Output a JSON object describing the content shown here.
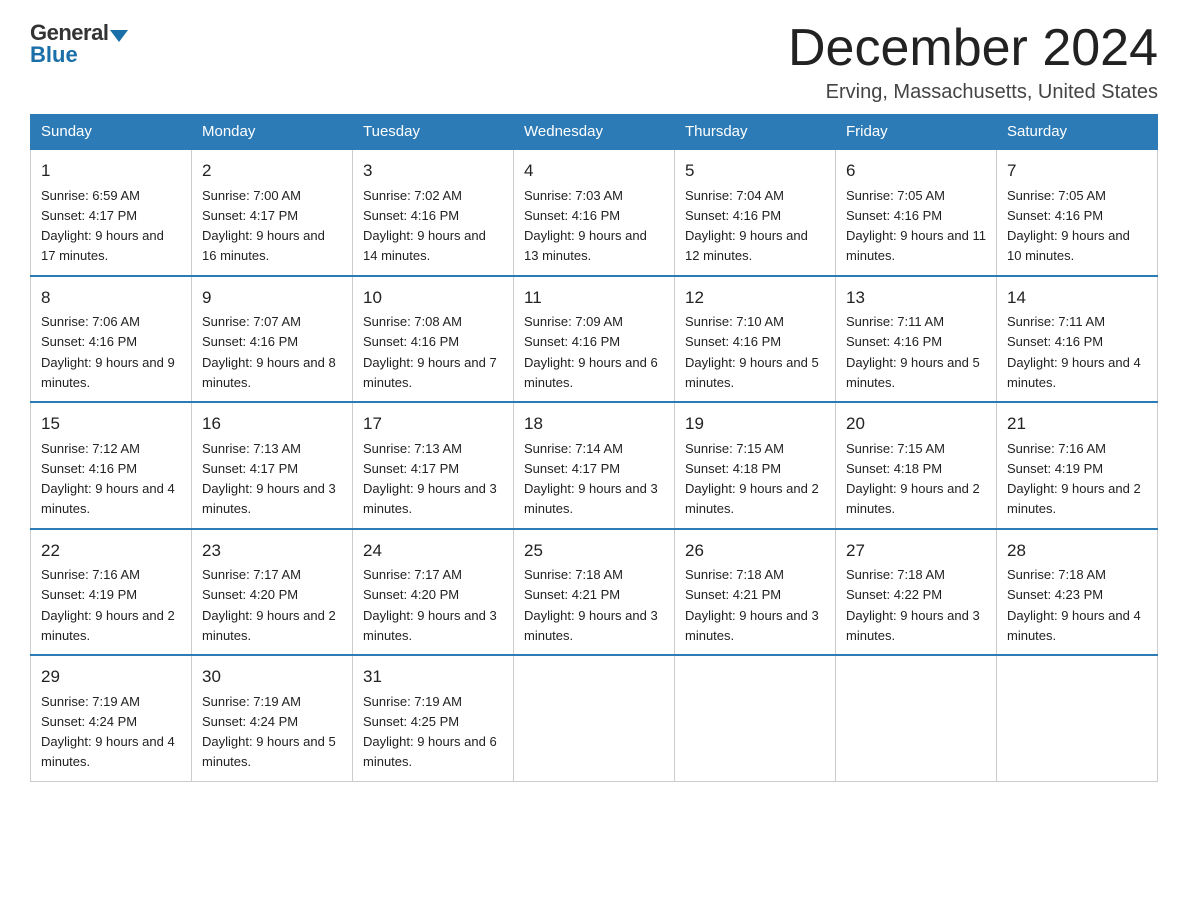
{
  "logo": {
    "general": "General",
    "blue": "Blue",
    "arrow": "▶"
  },
  "title": "December 2024",
  "location": "Erving, Massachusetts, United States",
  "days_of_week": [
    "Sunday",
    "Monday",
    "Tuesday",
    "Wednesday",
    "Thursday",
    "Friday",
    "Saturday"
  ],
  "weeks": [
    [
      {
        "day": "1",
        "sunrise": "6:59 AM",
        "sunset": "4:17 PM",
        "daylight": "9 hours and 17 minutes."
      },
      {
        "day": "2",
        "sunrise": "7:00 AM",
        "sunset": "4:17 PM",
        "daylight": "9 hours and 16 minutes."
      },
      {
        "day": "3",
        "sunrise": "7:02 AM",
        "sunset": "4:16 PM",
        "daylight": "9 hours and 14 minutes."
      },
      {
        "day": "4",
        "sunrise": "7:03 AM",
        "sunset": "4:16 PM",
        "daylight": "9 hours and 13 minutes."
      },
      {
        "day": "5",
        "sunrise": "7:04 AM",
        "sunset": "4:16 PM",
        "daylight": "9 hours and 12 minutes."
      },
      {
        "day": "6",
        "sunrise": "7:05 AM",
        "sunset": "4:16 PM",
        "daylight": "9 hours and 11 minutes."
      },
      {
        "day": "7",
        "sunrise": "7:05 AM",
        "sunset": "4:16 PM",
        "daylight": "9 hours and 10 minutes."
      }
    ],
    [
      {
        "day": "8",
        "sunrise": "7:06 AM",
        "sunset": "4:16 PM",
        "daylight": "9 hours and 9 minutes."
      },
      {
        "day": "9",
        "sunrise": "7:07 AM",
        "sunset": "4:16 PM",
        "daylight": "9 hours and 8 minutes."
      },
      {
        "day": "10",
        "sunrise": "7:08 AM",
        "sunset": "4:16 PM",
        "daylight": "9 hours and 7 minutes."
      },
      {
        "day": "11",
        "sunrise": "7:09 AM",
        "sunset": "4:16 PM",
        "daylight": "9 hours and 6 minutes."
      },
      {
        "day": "12",
        "sunrise": "7:10 AM",
        "sunset": "4:16 PM",
        "daylight": "9 hours and 5 minutes."
      },
      {
        "day": "13",
        "sunrise": "7:11 AM",
        "sunset": "4:16 PM",
        "daylight": "9 hours and 5 minutes."
      },
      {
        "day": "14",
        "sunrise": "7:11 AM",
        "sunset": "4:16 PM",
        "daylight": "9 hours and 4 minutes."
      }
    ],
    [
      {
        "day": "15",
        "sunrise": "7:12 AM",
        "sunset": "4:16 PM",
        "daylight": "9 hours and 4 minutes."
      },
      {
        "day": "16",
        "sunrise": "7:13 AM",
        "sunset": "4:17 PM",
        "daylight": "9 hours and 3 minutes."
      },
      {
        "day": "17",
        "sunrise": "7:13 AM",
        "sunset": "4:17 PM",
        "daylight": "9 hours and 3 minutes."
      },
      {
        "day": "18",
        "sunrise": "7:14 AM",
        "sunset": "4:17 PM",
        "daylight": "9 hours and 3 minutes."
      },
      {
        "day": "19",
        "sunrise": "7:15 AM",
        "sunset": "4:18 PM",
        "daylight": "9 hours and 2 minutes."
      },
      {
        "day": "20",
        "sunrise": "7:15 AM",
        "sunset": "4:18 PM",
        "daylight": "9 hours and 2 minutes."
      },
      {
        "day": "21",
        "sunrise": "7:16 AM",
        "sunset": "4:19 PM",
        "daylight": "9 hours and 2 minutes."
      }
    ],
    [
      {
        "day": "22",
        "sunrise": "7:16 AM",
        "sunset": "4:19 PM",
        "daylight": "9 hours and 2 minutes."
      },
      {
        "day": "23",
        "sunrise": "7:17 AM",
        "sunset": "4:20 PM",
        "daylight": "9 hours and 2 minutes."
      },
      {
        "day": "24",
        "sunrise": "7:17 AM",
        "sunset": "4:20 PM",
        "daylight": "9 hours and 3 minutes."
      },
      {
        "day": "25",
        "sunrise": "7:18 AM",
        "sunset": "4:21 PM",
        "daylight": "9 hours and 3 minutes."
      },
      {
        "day": "26",
        "sunrise": "7:18 AM",
        "sunset": "4:21 PM",
        "daylight": "9 hours and 3 minutes."
      },
      {
        "day": "27",
        "sunrise": "7:18 AM",
        "sunset": "4:22 PM",
        "daylight": "9 hours and 3 minutes."
      },
      {
        "day": "28",
        "sunrise": "7:18 AM",
        "sunset": "4:23 PM",
        "daylight": "9 hours and 4 minutes."
      }
    ],
    [
      {
        "day": "29",
        "sunrise": "7:19 AM",
        "sunset": "4:24 PM",
        "daylight": "9 hours and 4 minutes."
      },
      {
        "day": "30",
        "sunrise": "7:19 AM",
        "sunset": "4:24 PM",
        "daylight": "9 hours and 5 minutes."
      },
      {
        "day": "31",
        "sunrise": "7:19 AM",
        "sunset": "4:25 PM",
        "daylight": "9 hours and 6 minutes."
      },
      null,
      null,
      null,
      null
    ]
  ]
}
